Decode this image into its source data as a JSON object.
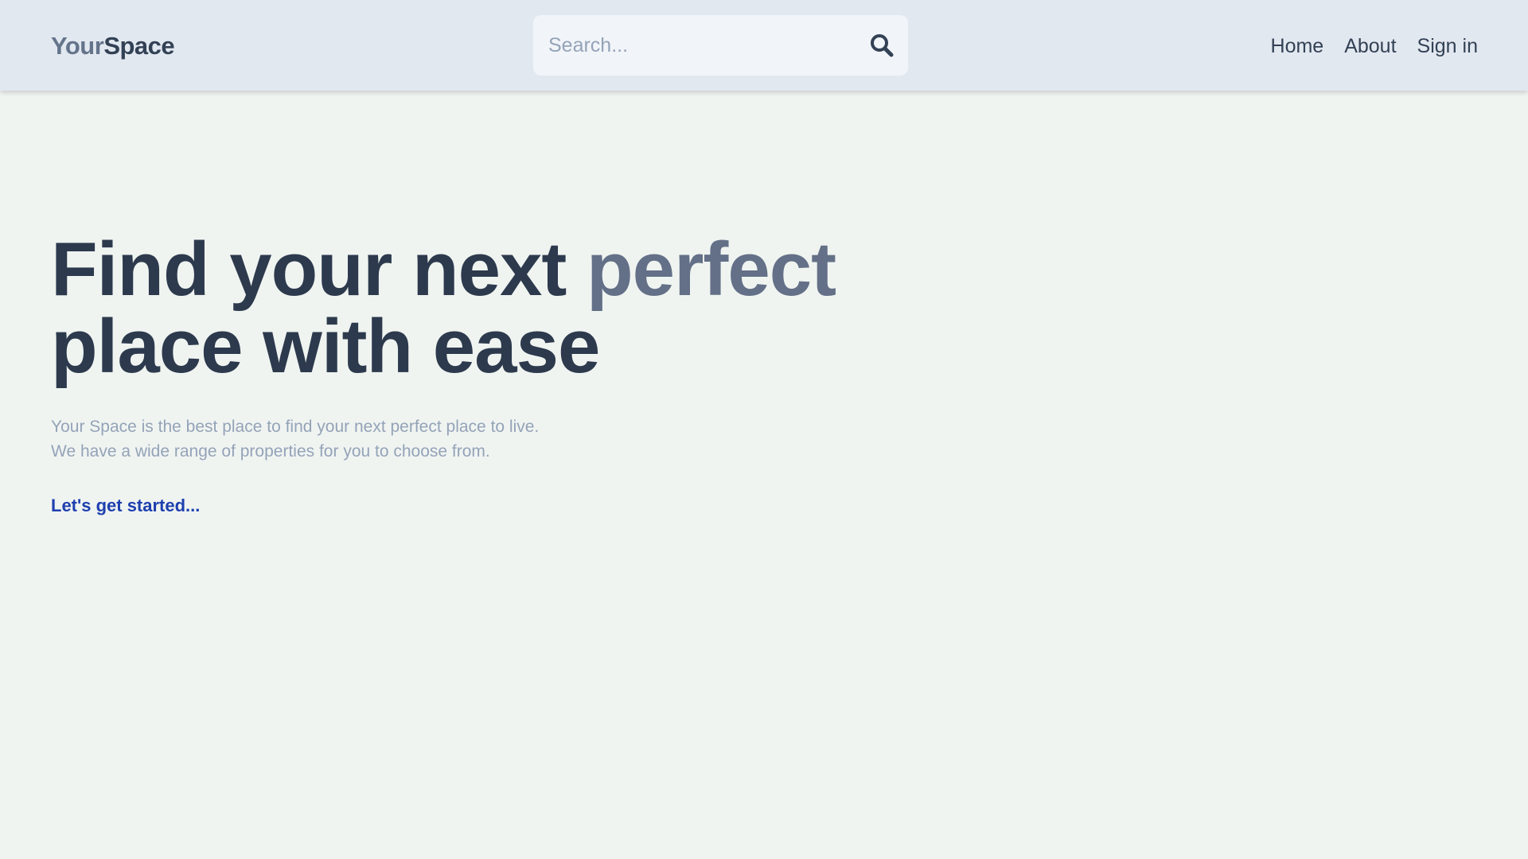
{
  "colors": {
    "page_background": "#f0f4f1",
    "navbar_background": "#e2e8f0",
    "headline": "#2d3a4d",
    "headline_accent": "#637087",
    "subtext": "#94a3b8",
    "cta": "#1e40af"
  },
  "navbar": {
    "logo": {
      "part1": "Your",
      "part2": "Space"
    },
    "search": {
      "placeholder": "Search...",
      "value": "",
      "icon": "search-icon"
    },
    "links": [
      {
        "label": "Home"
      },
      {
        "label": "About"
      },
      {
        "label": "Sign in"
      }
    ]
  },
  "hero": {
    "headline_part1": "Find your next ",
    "headline_accent": "perfect",
    "headline_part2": "place with ease",
    "subtext_line1": "Your Space is the best place to find your next perfect place to live.",
    "subtext_line2": "We have a wide range of properties for you to choose from.",
    "cta_label": "Let's get started..."
  }
}
